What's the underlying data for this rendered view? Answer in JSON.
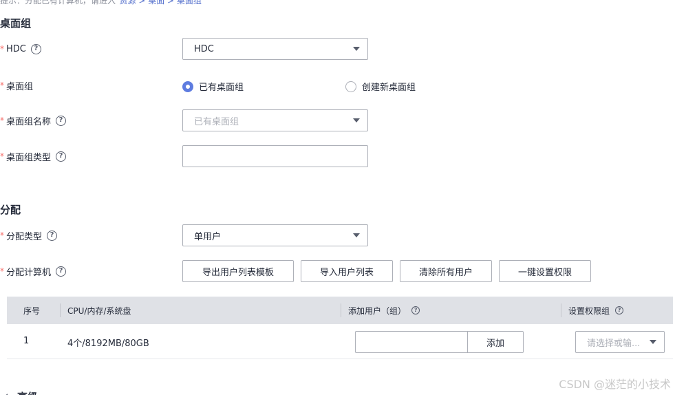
{
  "tip": {
    "prefix": "提示：分配已有计算机，请进入",
    "path": "\"资源 > 桌面 > 桌面组\""
  },
  "desktop_group_section": {
    "title": "桌面组",
    "hdc": {
      "label": "HDC",
      "value": "HDC"
    },
    "group": {
      "label": "桌面组",
      "option_existing": "已有桌面组",
      "option_new": "创建新桌面组",
      "selected": "已有桌面组"
    },
    "group_name": {
      "label": "桌面组名称",
      "placeholder": "已有桌面组"
    },
    "group_type": {
      "label": "桌面组类型",
      "value": ""
    }
  },
  "assign_section": {
    "title": "分配",
    "assign_type": {
      "label": "分配类型",
      "value": "单用户"
    },
    "assign_computer": {
      "label": "分配计算机",
      "buttons": [
        "导出用户列表模板",
        "导入用户列表",
        "清除所有用户",
        "一键设置权限"
      ]
    },
    "table": {
      "headers": [
        "序号",
        "CPU/内存/系统盘",
        "添加用户（组）",
        "设置权限组"
      ],
      "rows": [
        {
          "index": "1",
          "spec": "4个/8192MB/80GB",
          "user_value": "",
          "add_label": "添加",
          "perm_placeholder": "请选择或输..."
        }
      ]
    }
  },
  "advanced": {
    "label": "高级"
  },
  "watermark": "CSDN @迷茫的小技术",
  "colors": {
    "accent": "#5e7ce0",
    "required": "#f66f6a",
    "link": "#526ecc",
    "table_header_bg": "#dfe1e6"
  },
  "icons": {
    "help": "question-circle-icon",
    "dropdown": "caret-down-icon",
    "collapse": "caret-left-icon"
  }
}
